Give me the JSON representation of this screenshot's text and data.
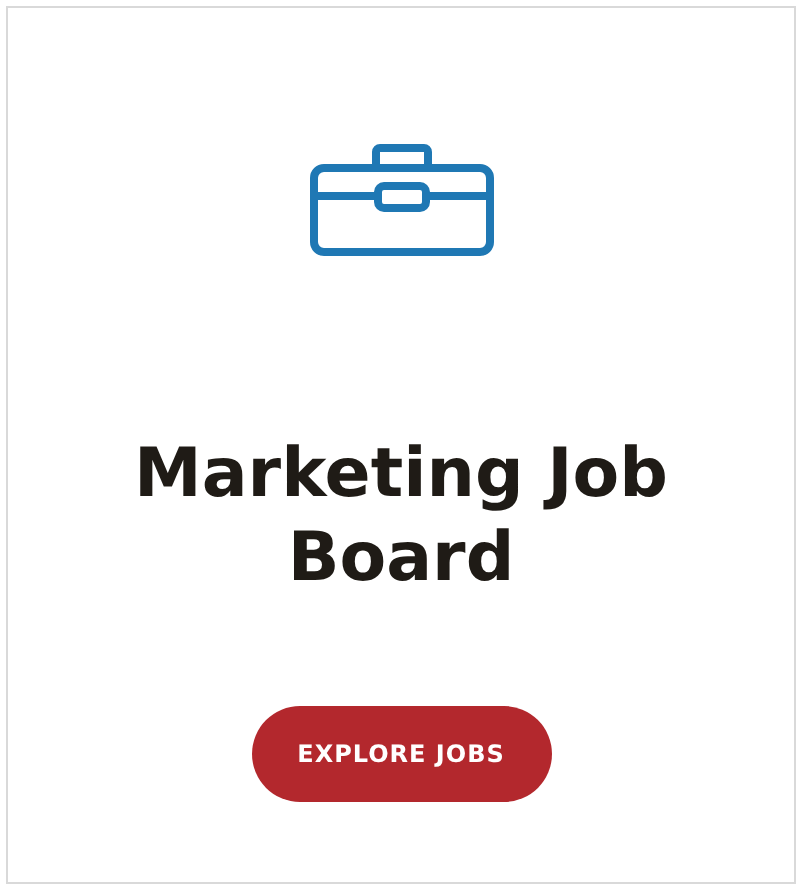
{
  "card": {
    "title": "Marketing Job Board",
    "button": "EXPLORE JOBS"
  }
}
